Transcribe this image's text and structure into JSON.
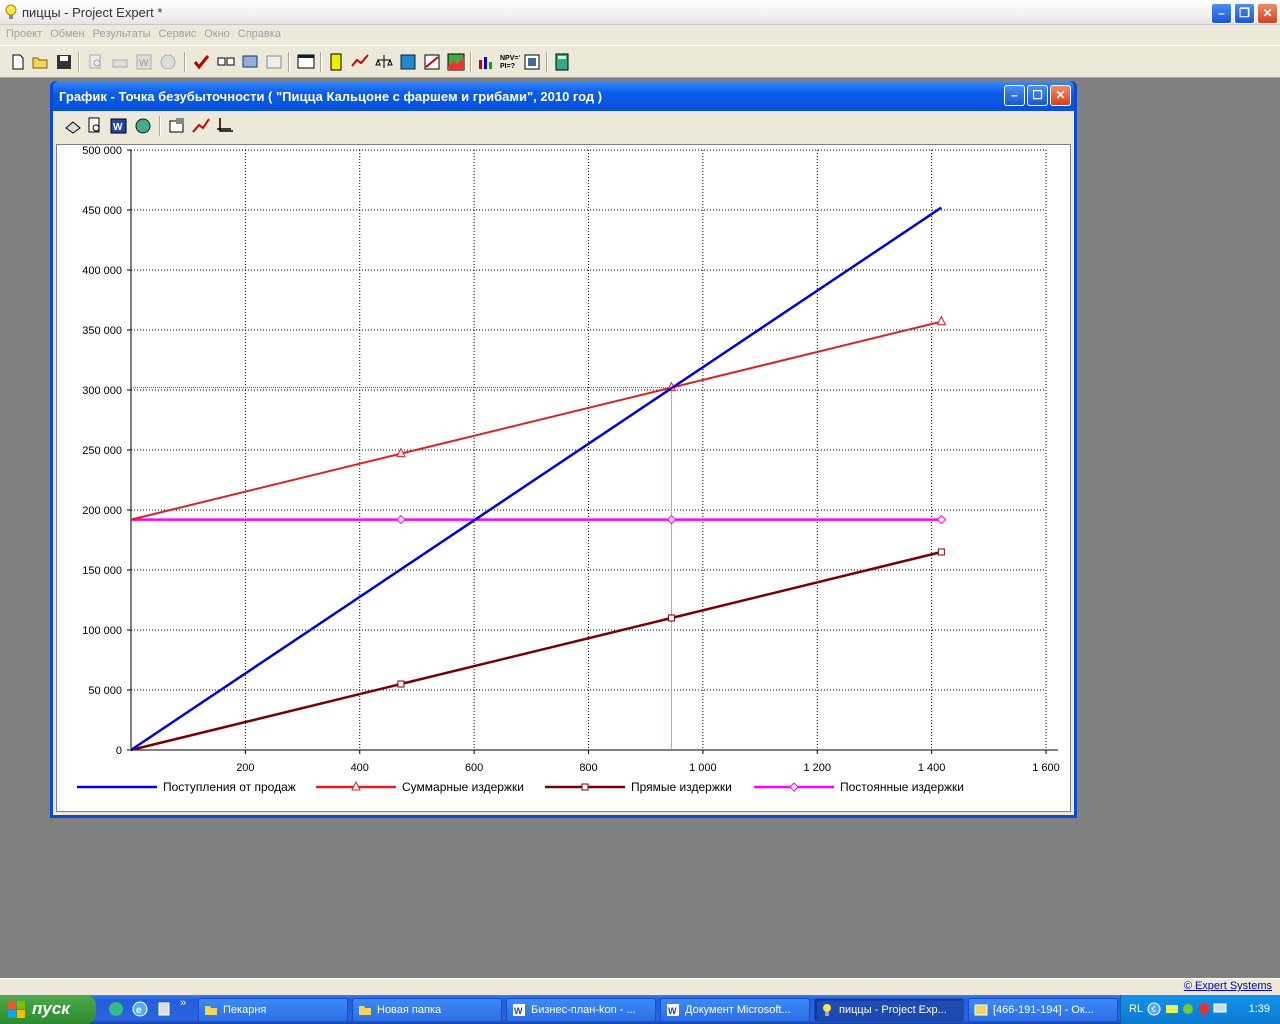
{
  "app": {
    "title": "пиццы - Project Expert *"
  },
  "menu": [
    "Проект",
    "Обмен",
    "Результаты",
    "Сервис",
    "Окно",
    "Справка"
  ],
  "child_window": {
    "title": "График - Точка безубыточности ( \"Пицца Кальцоне с фаршем и грибами\", 2010 год )"
  },
  "chart_data": {
    "type": "line",
    "title": "",
    "xlabel": "",
    "ylabel": "",
    "xlim": [
      0,
      1600
    ],
    "ylim": [
      0,
      500000
    ],
    "x_ticks": [
      200,
      400,
      600,
      800,
      1000,
      1200,
      1400,
      1600
    ],
    "x_tick_labels": [
      "200",
      "400",
      "600",
      "800",
      "1 000",
      "1 200",
      "1 400",
      "1 600"
    ],
    "y_ticks": [
      0,
      50000,
      100000,
      150000,
      200000,
      250000,
      300000,
      350000,
      400000,
      450000,
      500000
    ],
    "y_tick_labels": [
      "0",
      "50 000",
      "100 000",
      "150 000",
      "200 000",
      "250 000",
      "300 000",
      "350 000",
      "400 000",
      "450 000",
      "500 000"
    ],
    "grid": true,
    "legend_position": "bottom",
    "series": [
      {
        "name": "Поступления от продаж",
        "color": "#0000dd",
        "marker": "none",
        "x": [
          0,
          1417
        ],
        "y": [
          0,
          452000
        ]
      },
      {
        "name": "Суммарные издержки",
        "color": "#e02020",
        "marker": "triangle",
        "x": [
          0,
          472,
          945,
          1417
        ],
        "y": [
          192000,
          247000,
          302000,
          357000
        ]
      },
      {
        "name": "Прямые издержки",
        "color": "#7a0000",
        "marker": "square",
        "x": [
          0,
          472,
          945,
          1417
        ],
        "y": [
          0,
          55000,
          110000,
          165000
        ]
      },
      {
        "name": "Постоянные издержки",
        "color": "#ff00ff",
        "marker": "diamond",
        "x": [
          0,
          472,
          945,
          1417
        ],
        "y": [
          192000,
          192000,
          192000,
          192000
        ]
      }
    ],
    "break_even": {
      "x": 945,
      "y": 302000,
      "color": "#e02020"
    }
  },
  "status": {
    "link": "© Expert Systems"
  },
  "taskbar": {
    "start": "пуск",
    "tasks": [
      {
        "label": "Пекарня",
        "active": false
      },
      {
        "label": "Новая папка",
        "active": false
      },
      {
        "label": "Бизнес-план-kon - ...",
        "active": false
      },
      {
        "label": "Документ Microsoft...",
        "active": false
      },
      {
        "label": "пиццы - Project Exp...",
        "active": true
      },
      {
        "label": "[466-191-194] - Ок...",
        "active": false
      }
    ],
    "lang": "RL",
    "clock": "1:39"
  }
}
